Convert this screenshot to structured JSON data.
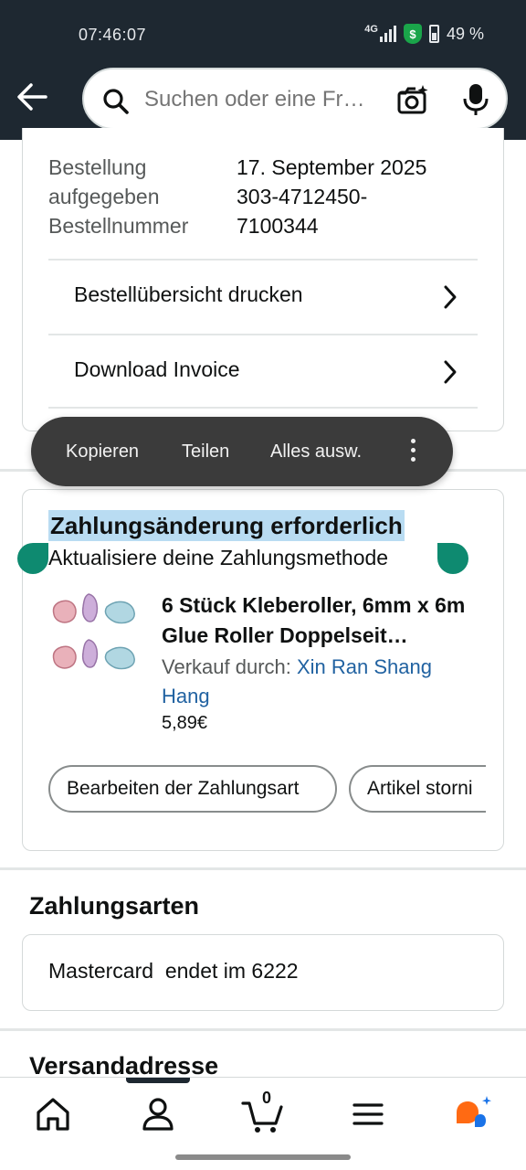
{
  "status_bar": {
    "time": "07:46:07",
    "network": "4G",
    "battery": "49 %",
    "shield_symbol": "$"
  },
  "search": {
    "placeholder": "Suchen oder eine Fr…"
  },
  "order": {
    "placed_label": "Bestellung aufgegeben",
    "placed_label_line1": "Bestellung",
    "placed_label_line2": "aufgegeben",
    "date": "17. September 2025",
    "number_label": "Bestellnummer",
    "number_line1": "303-4712450-",
    "number_line2": "7100344",
    "print_link": "Bestellübersicht drucken",
    "invoice_link": "Download Invoice"
  },
  "selection_toolbar": {
    "copy": "Kopieren",
    "share": "Teilen",
    "select_all": "Alles ausw."
  },
  "payment_change": {
    "title": "Zahlungsänderung erforderlich",
    "subtitle": "Aktualisiere deine Zahlungsmethode",
    "product_title": "6 Stück Kleberoller, 6mm x 6m Glue Roller Doppelseit…",
    "sold_by_label": "Verkauf durch:",
    "seller": "Xin Ran Shang Hang",
    "price": "5,89€",
    "edit_payment_button": "Bearbeiten der Zahlungsart",
    "cancel_item_button": "Artikel storni"
  },
  "payment_methods": {
    "heading": "Zahlungsarten",
    "card": "Mastercard  endet im 6222"
  },
  "shipping": {
    "heading": "Versandadresse"
  },
  "bottom_nav": {
    "cart_count": "0",
    "items": [
      "home-icon",
      "account-icon",
      "cart-icon",
      "menu-icon",
      "rufus-icon"
    ]
  },
  "colors": {
    "header_bg": "#1e2831",
    "selection_highlight": "#b9dcf2",
    "selection_handle": "#0e8a70",
    "link": "#2162a1",
    "toolbar_bg": "#3b3b3b"
  }
}
